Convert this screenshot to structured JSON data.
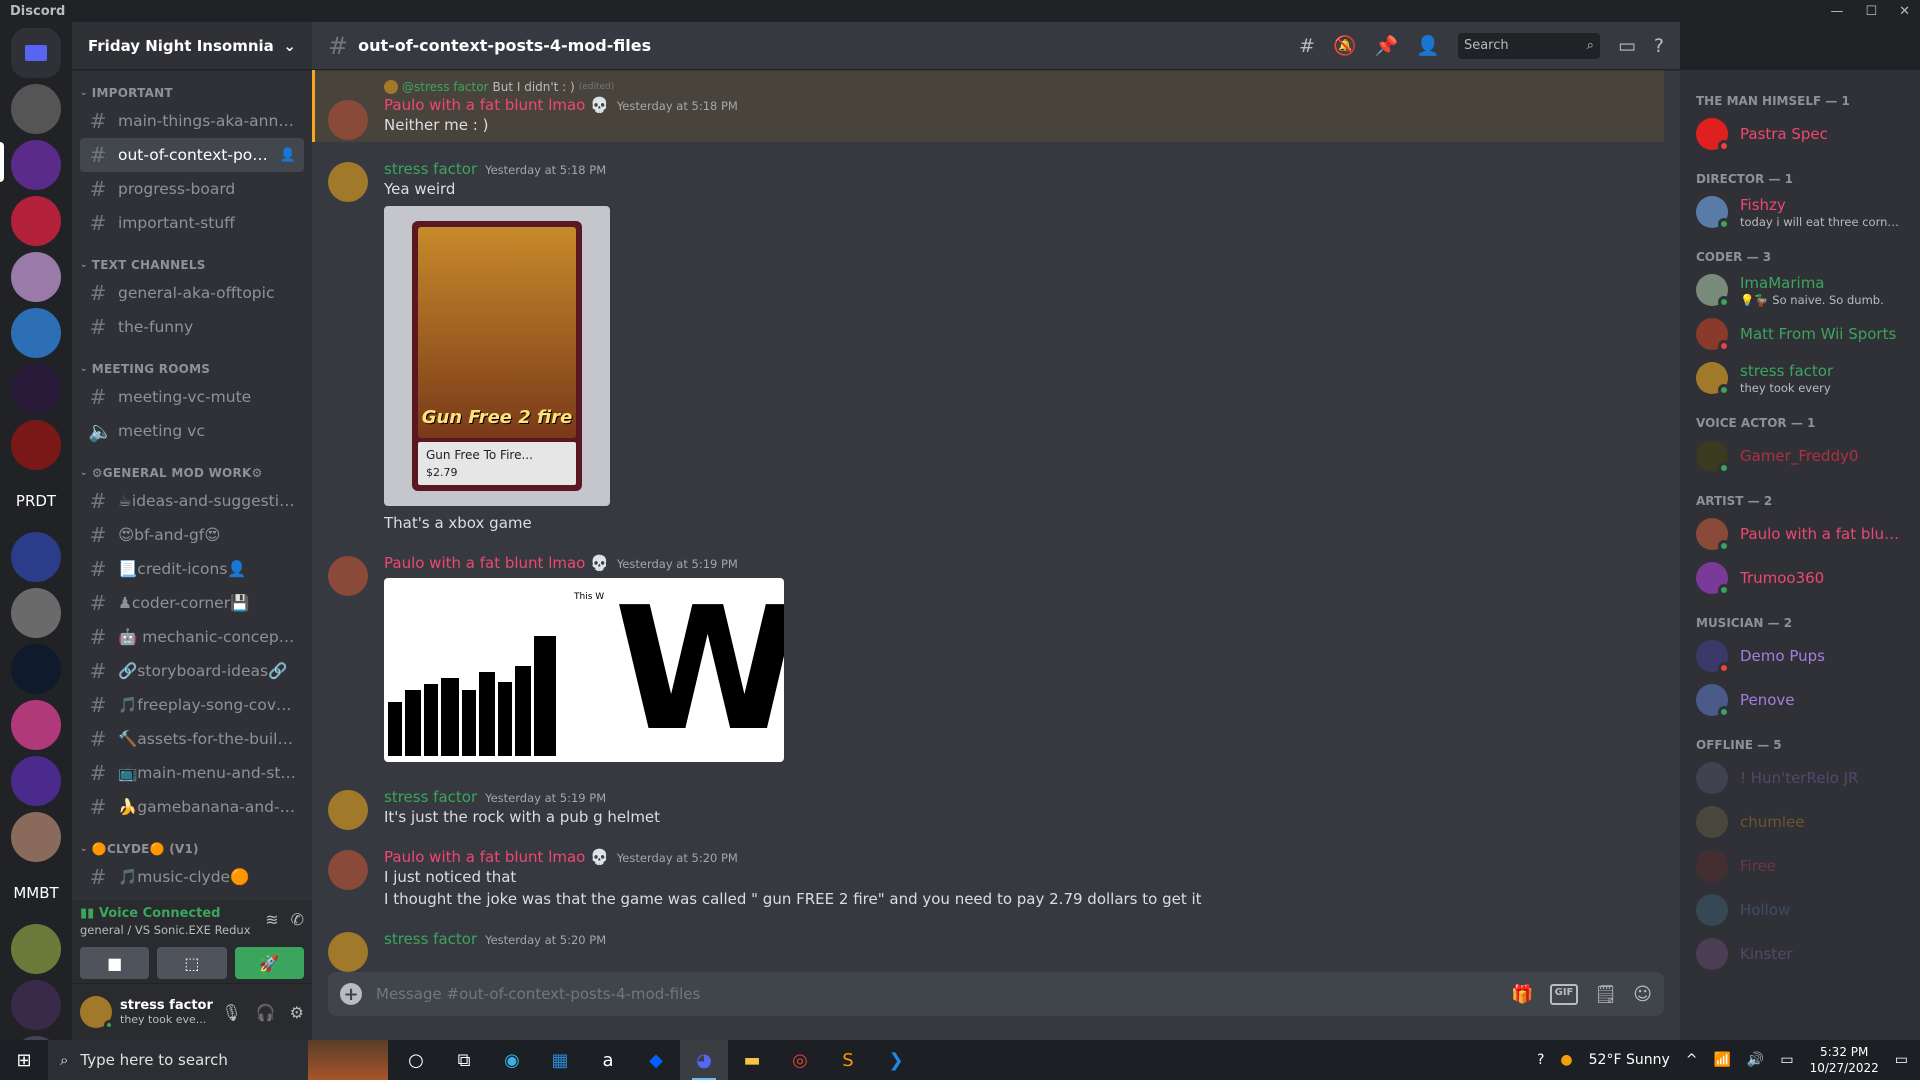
{
  "app": {
    "title": "Discord"
  },
  "guilds": [
    {
      "kind": "icon",
      "color": "#5865f2"
    },
    {
      "kind": "avatar",
      "color": "#555"
    },
    {
      "kind": "avatar",
      "color": "#5b2b8a"
    },
    {
      "kind": "avatar",
      "color": "#b3223a"
    },
    {
      "kind": "avatar",
      "color": "#9a7aa8"
    },
    {
      "kind": "avatar",
      "color": "#2c6fb5"
    },
    {
      "kind": "avatar",
      "color": "#2a1a3a"
    },
    {
      "kind": "avatar",
      "color": "#7a1818"
    },
    {
      "kind": "text",
      "label": "PRDT"
    },
    {
      "kind": "avatar",
      "color": "#2b3c8a"
    },
    {
      "kind": "avatar",
      "color": "#6a6a6a"
    },
    {
      "kind": "avatar",
      "color": "#0f1a2a"
    },
    {
      "kind": "avatar",
      "color": "#b0397a"
    },
    {
      "kind": "avatar",
      "color": "#4a2a8a"
    },
    {
      "kind": "avatar",
      "color": "#8a6a5a"
    },
    {
      "kind": "text",
      "label": "MMBT"
    },
    {
      "kind": "avatar",
      "color": "#6b7a3a"
    },
    {
      "kind": "avatar",
      "color": "#3a2a4a"
    },
    {
      "kind": "avatar",
      "color": "#445"
    }
  ],
  "server": {
    "name": "Friday Night Insomnia"
  },
  "categories": [
    {
      "name": "IMPORTANT",
      "channels": [
        {
          "name": "main-things-aka-annou...",
          "type": "text"
        },
        {
          "name": "out-of-context-posts-...",
          "type": "text",
          "active": true
        },
        {
          "name": "progress-board",
          "type": "text"
        },
        {
          "name": "important-stuff",
          "type": "text"
        }
      ]
    },
    {
      "name": "TEXT CHANNELS",
      "channels": [
        {
          "name": "general-aka-offtopic",
          "type": "text"
        },
        {
          "name": "the-funny",
          "type": "text"
        }
      ]
    },
    {
      "name": "MEETING ROOMS",
      "channels": [
        {
          "name": "meeting-vc-mute",
          "type": "text"
        },
        {
          "name": "meeting vc",
          "type": "voice"
        }
      ]
    },
    {
      "name": "⚙GENERAL MOD WORK⚙",
      "channels": [
        {
          "name": "☕ideas-and-suggestio...",
          "type": "text"
        },
        {
          "name": "😍bf-and-gf😍",
          "type": "text"
        },
        {
          "name": "📃credit-icons👤",
          "type": "text"
        },
        {
          "name": "♟coder-corner💾",
          "type": "text"
        },
        {
          "name": "🤖 mechanic-concepts...",
          "type": "text"
        },
        {
          "name": "🔗storyboard-ideas🔗",
          "type": "text"
        },
        {
          "name": "🎵freeplay-song-cover...",
          "type": "text"
        },
        {
          "name": "🔨assets-for-the-build...",
          "type": "text"
        },
        {
          "name": "📺main-menu-and-sto...",
          "type": "text"
        },
        {
          "name": "🍌gamebanana-and-s...",
          "type": "text"
        }
      ]
    },
    {
      "name": "🟠CLYDE🟠 (V1)",
      "channels": [
        {
          "name": "🎵music-clyde🟠",
          "type": "text"
        }
      ]
    }
  ],
  "voice": {
    "status": "Voice Connected",
    "location": "general / VS Sonic.EXE Redux"
  },
  "user": {
    "name": "stress factor",
    "status": "they took eve..."
  },
  "channel": {
    "name": "out-of-context-posts-4-mod-files"
  },
  "search": {
    "placeholder": "Search"
  },
  "messages": [
    {
      "author": "Paulo with a fat blunt lmao 💀",
      "color": "#f04770",
      "time": "Yesterday at 5:18 PM",
      "highlight": true,
      "reply": {
        "name": "@stress factor",
        "text": "But I didn't : )",
        "edited": "(edited)"
      },
      "lines": [
        "Neither me : )"
      ]
    },
    {
      "author": "stress factor",
      "color": "#3ba55d",
      "time": "Yesterday at 5:18 PM",
      "lines": [
        "Yea weird"
      ],
      "attachment": "card",
      "after": [
        "That's a xbox game"
      ]
    },
    {
      "author": "Paulo with a fat blunt lmao 💀",
      "color": "#f04770",
      "time": "Yesterday at 5:19 PM",
      "lines": [],
      "attachment": "w"
    },
    {
      "author": "stress factor",
      "color": "#3ba55d",
      "time": "Yesterday at 5:19 PM",
      "lines": [
        "It's just the rock with a pub g helmet"
      ]
    },
    {
      "author": "Paulo with a fat blunt lmao 💀",
      "color": "#f04770",
      "time": "Yesterday at 5:20 PM",
      "lines": [
        "I just noticed that",
        "I thought the joke was that the game was called \" gun FREE 2 fire\" and you need to pay 2.79 dollars to get it"
      ]
    },
    {
      "author": "stress factor",
      "color": "#3ba55d",
      "time": "Yesterday at 5:20 PM",
      "lines": []
    }
  ],
  "card": {
    "title": "Gun Free 2 fire",
    "name": "Gun Free To Fire...",
    "price": "$2.79"
  },
  "wimage": {
    "caption": "This W",
    "letter": "W"
  },
  "composer": {
    "placeholder": "Message #out-of-context-posts-4-mod-files",
    "gif": "GIF"
  },
  "members": [
    {
      "role": "THE MAN HIMSELF — 1",
      "users": [
        {
          "name": "Pastra Spec",
          "color": "#f04770",
          "status": "",
          "dot": "#ed4245",
          "av": "#e02020"
        }
      ]
    },
    {
      "role": "DIRECTOR — 1",
      "users": [
        {
          "name": "Fishzy",
          "color": "#f04770",
          "status": "today i will eat three corndogs",
          "dot": "#3ba55d",
          "av": "#5a7aa8"
        }
      ]
    },
    {
      "role": "CODER — 3",
      "users": [
        {
          "name": "ImaMarima",
          "color": "#3ba55d",
          "status": "💡🦆 So naive. So dumb.",
          "dot": "#3ba55d",
          "av": "#7a8a7a"
        },
        {
          "name": "Matt From Wii Sports",
          "color": "#3ba55d",
          "status": "",
          "dot": "#ed4245",
          "av": "#8a3a2a"
        },
        {
          "name": "stress factor",
          "color": "#3ba55d",
          "status": "they took every",
          "dot": "#3ba55d",
          "av": "#a07a2a"
        }
      ]
    },
    {
      "role": "VOICE ACTOR — 1",
      "users": [
        {
          "name": "Gamer_Freddy0",
          "color": "#b03040",
          "status": "",
          "dot": "#3ba55d",
          "av": "#3a3a20"
        }
      ]
    },
    {
      "role": "ARTIST — 2",
      "users": [
        {
          "name": "Paulo with a fat blunt l...",
          "color": "#f04770",
          "status": "",
          "dot": "#3ba55d",
          "av": "#8a4a3a"
        },
        {
          "name": "Trumoo360",
          "color": "#f04770",
          "status": "",
          "dot": "#3ba55d",
          "av": "#7a3a9a"
        }
      ]
    },
    {
      "role": "MUSICIAN — 2",
      "users": [
        {
          "name": "Demo Pups",
          "color": "#a67ce0",
          "status": "",
          "dot": "#ed4245",
          "av": "#3a3a6a"
        },
        {
          "name": "Penove",
          "color": "#a67ce0",
          "status": "",
          "dot": "#3ba55d",
          "av": "#4a5a8a"
        }
      ]
    },
    {
      "role": "OFFLINE — 5",
      "users": [
        {
          "name": "! Hun'terRelo JR",
          "color": "#a67ce0",
          "status": "",
          "off": true,
          "av": "#6a6a8a"
        },
        {
          "name": "chumlee",
          "color": "#faa61a",
          "status": "",
          "off": true,
          "av": "#8a7a4a"
        },
        {
          "name": "Firee",
          "color": "#f04770",
          "status": "",
          "off": true,
          "av": "#7a2a2a"
        },
        {
          "name": "Hollow",
          "color": "#5a8ad0",
          "status": "",
          "off": true,
          "av": "#4a7a9a"
        },
        {
          "name": "Kinster",
          "color": "#a67ce0",
          "status": "",
          "off": true,
          "av": "#8a5a9a"
        }
      ]
    }
  ],
  "taskbar": {
    "search": "Type here to search",
    "weather": "52°F  Sunny",
    "time": "5:32 PM",
    "date": "10/27/2022"
  }
}
